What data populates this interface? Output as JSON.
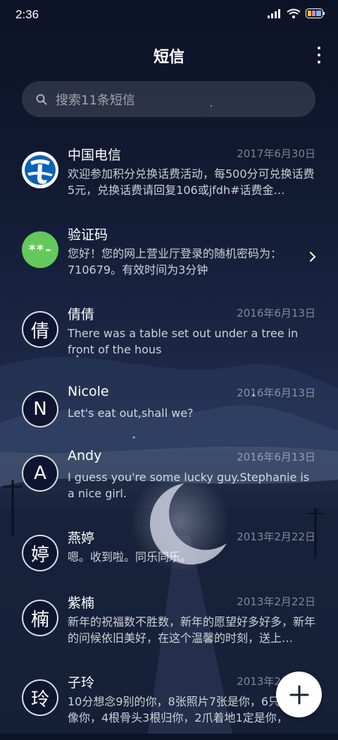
{
  "status": {
    "time": "2:36"
  },
  "header": {
    "title": "短信"
  },
  "search": {
    "placeholder": "搜索11条短信"
  },
  "messages": [
    {
      "name": "中国电信",
      "date": "2017年6月30日",
      "preview": "欢迎参加积分兑换话费活动，每500分可兑换话费5元，兑换话费请回复106或jfdh#话费金…",
      "avatar_icon": "china-telecom-logo"
    },
    {
      "name": "验证码",
      "date": "",
      "preview": "您好！您的网上营业厅登录的随机密码为：710679。有效时间为3分钟",
      "avatar_text": "**-"
    },
    {
      "name": "倩倩",
      "date": "2016年6月13日",
      "preview": "There was a table set out under a tree in front of the hous",
      "avatar_text": "倩"
    },
    {
      "name": "Nicole",
      "date": "2016年6月13日",
      "preview": "Let's eat out,shall we?",
      "avatar_text": "N"
    },
    {
      "name": "Andy",
      "date": "2016年6月13日",
      "preview": "I guess you're some lucky guy.Stephanie is a nice girl.",
      "avatar_text": "A"
    },
    {
      "name": "燕婷",
      "date": "2013年2月22日",
      "preview": "嗯。收到啦。同乐同乐。",
      "avatar_text": "婷"
    },
    {
      "name": "紫楠",
      "date": "2013年2月22日",
      "preview": "新年的祝福数不胜数，新年的愿望好多好多，新年的问候依旧美好，在这个温馨的时刻，送上…",
      "avatar_text": "楠"
    },
    {
      "name": "子玲",
      "date": "2013年2月22日",
      "preview": "10分想念9别的你，8张照片7张是你，6只小猪只像你，4根骨头3根归你，2爪着地1定是你，",
      "avatar_text": "玲"
    }
  ],
  "fab": {
    "icon": "plus-icon"
  },
  "colors": {
    "background": "#131b33",
    "green_avatar": "#64c95a",
    "telecom_blue": "#0a63b6"
  }
}
